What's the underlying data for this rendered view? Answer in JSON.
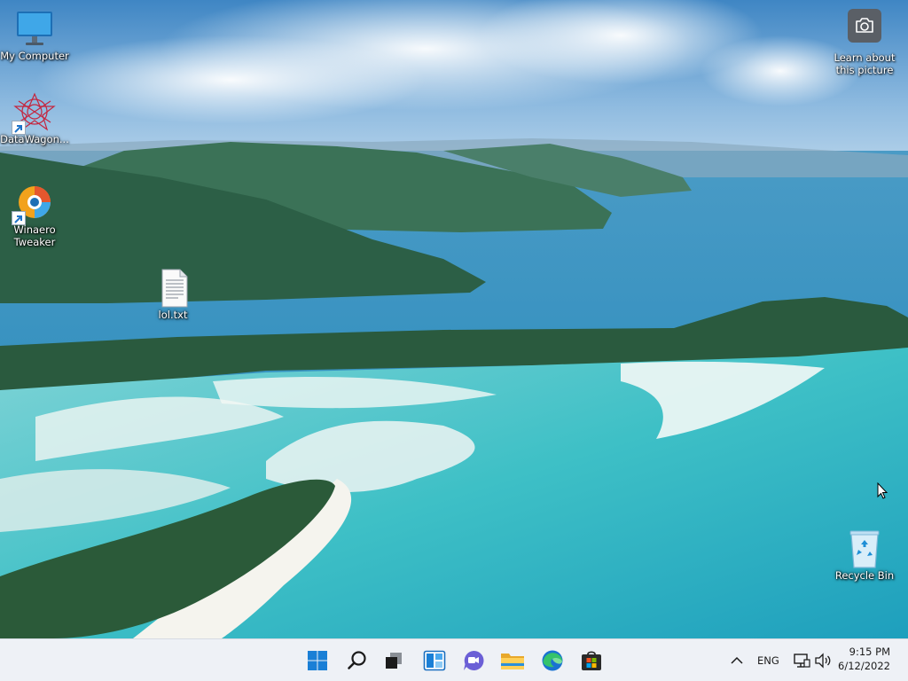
{
  "desktop": {
    "icons": [
      {
        "label": "My Computer",
        "icon": "monitor-icon"
      },
      {
        "label": "DataWagon...",
        "icon": "datawagon-icon"
      },
      {
        "label": "Winaero Tweaker",
        "label_line1": "Winaero",
        "label_line2": "Tweaker",
        "icon": "winaero-tweaker-icon"
      },
      {
        "label": "lol.txt",
        "icon": "text-file-icon"
      },
      {
        "label": "Recycle Bin",
        "icon": "recycle-bin-icon"
      }
    ],
    "learn_about": {
      "line1": "Learn about",
      "line2": "this picture",
      "icon": "camera-icon"
    }
  },
  "taskbar": {
    "apps": [
      "start",
      "search",
      "task-view",
      "widgets",
      "chat",
      "file-explorer",
      "edge",
      "store"
    ],
    "tray": {
      "language": "ENG",
      "time": "9:15 PM",
      "date": "6/12/2022"
    }
  },
  "colors": {
    "taskbar_bg": "#eef1f6",
    "accent": "#0067c0"
  }
}
